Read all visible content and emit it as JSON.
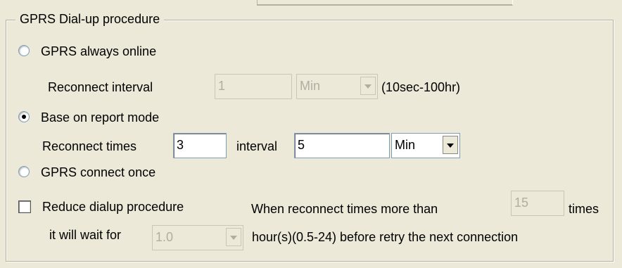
{
  "group": {
    "title": "GPRS Dial-up procedure"
  },
  "always_online": {
    "label": "GPRS always online",
    "selected": false
  },
  "reconnect_interval": {
    "label": "Reconnect interval",
    "value": "1",
    "unit": "Min",
    "range": "(10sec-100hr)",
    "enabled": false
  },
  "report_mode": {
    "label": "Base on report mode",
    "selected": true
  },
  "reconnect_times": {
    "label": "Reconnect times",
    "value": "3",
    "interval_label": "interval",
    "interval_value": "5",
    "unit": "Min"
  },
  "connect_once": {
    "label": "GPRS connect once",
    "selected": false
  },
  "reduce_dialup": {
    "label": "Reduce dialup procedure",
    "checked": false,
    "when_label": "When reconnect times more than",
    "times_value": "15",
    "times_label": "times",
    "wait_label": "it will wait for",
    "wait_value": "1.0",
    "retry_label": "hour(s)(0.5-24) before retry the next connection"
  }
}
